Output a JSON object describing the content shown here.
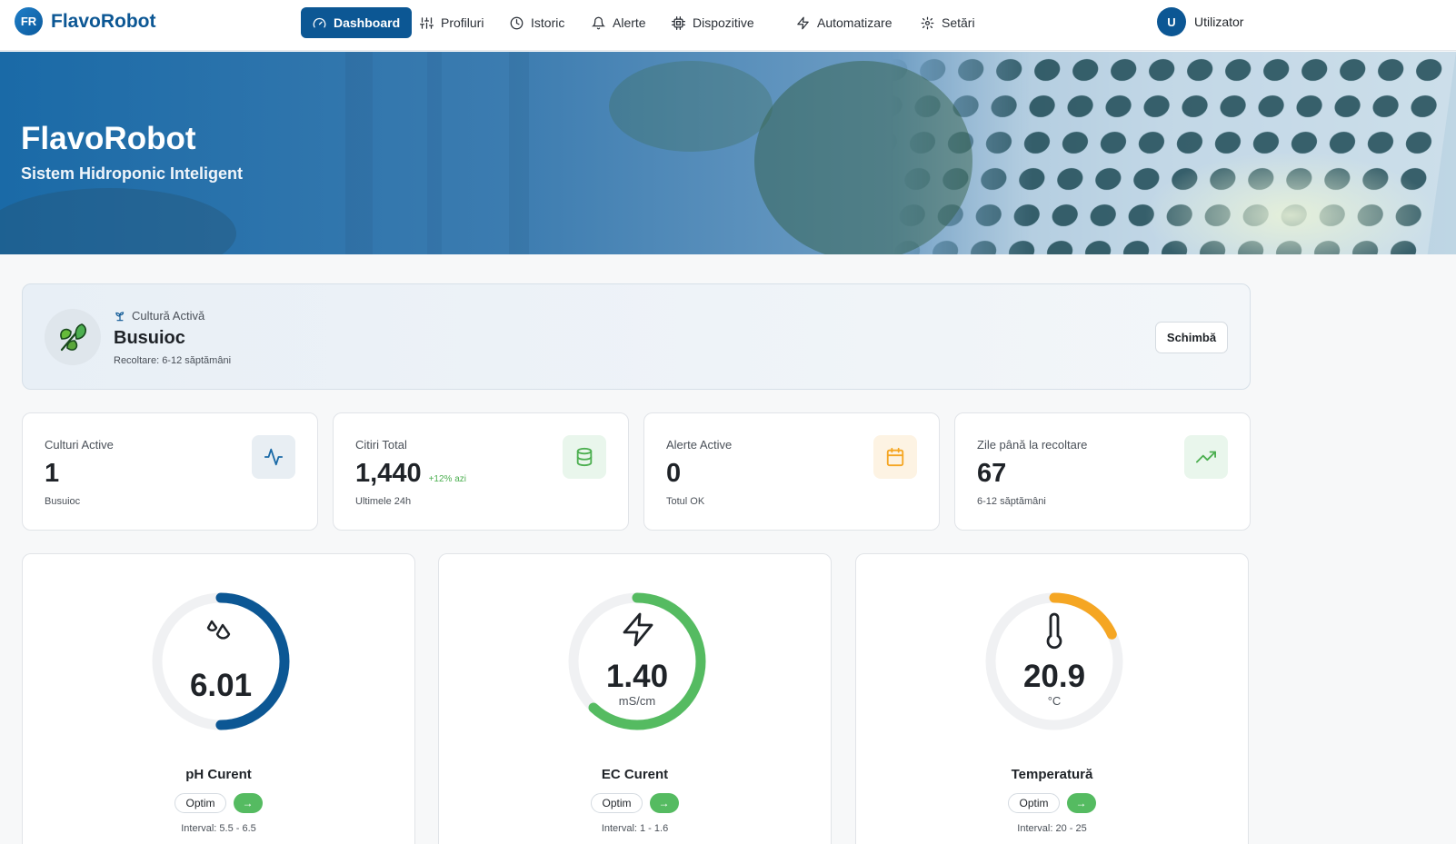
{
  "brand": {
    "logo_initials": "FR",
    "name": "FlavoRobot"
  },
  "nav": {
    "items": [
      {
        "label": "Dashboard",
        "icon": "gauge-icon",
        "active": true
      },
      {
        "label": "Profiluri",
        "icon": "sliders-icon"
      },
      {
        "label": "Istoric",
        "icon": "clock-icon"
      },
      {
        "label": "Alerte",
        "icon": "bell-icon"
      },
      {
        "label": "Dispozitive",
        "icon": "chip-icon"
      },
      {
        "label": "Automatizare",
        "icon": "zap-icon"
      },
      {
        "label": "Setări",
        "icon": "gear-icon"
      }
    ],
    "user": {
      "initial": "U",
      "name": "Utilizator"
    }
  },
  "hero": {
    "title": "FlavoRobot",
    "subtitle": "Sistem Hidroponic Inteligent"
  },
  "active_crop": {
    "label": "Cultură Activă",
    "name": "Busuioc",
    "harvest": "Recoltare: 6-12 săptămâni",
    "change_button": "Schimbă",
    "icon": "basil-leaf-icon"
  },
  "stats": [
    {
      "label": "Culturi Active",
      "value": "1",
      "delta": "",
      "sub": "Busuioc",
      "icon": "activity-icon",
      "color": "#1a6aa7",
      "bg": "#e8eef3"
    },
    {
      "label": "Citiri Total",
      "value": "1,440",
      "delta": "+12% azi",
      "sub": "Ultimele 24h",
      "icon": "database-icon",
      "color": "#4caf50",
      "bg": "#e9f6ec"
    },
    {
      "label": "Alerte Active",
      "value": "0",
      "delta": "",
      "sub": "Totul OK",
      "icon": "calendar-icon",
      "color": "#f5a623",
      "bg": "#fdf3e3"
    },
    {
      "label": "Zile până la recoltare",
      "value": "67",
      "delta": "",
      "sub": "6-12 săptămâni",
      "icon": "trending-up-icon",
      "color": "#4caf50",
      "bg": "#e9f6ec"
    }
  ],
  "gauges": [
    {
      "title": "pH Curent",
      "value": "6.01",
      "unit": "",
      "fraction": 0.5,
      "color": "#0c5794",
      "icon": "droplets-icon",
      "status": "Optim",
      "trend": "→",
      "range": "Interval: 5.5 - 6.5"
    },
    {
      "title": "EC Curent",
      "value": "1.40",
      "unit": "mS/cm",
      "fraction": 0.62,
      "color": "#55bb61",
      "icon": "zap-icon",
      "status": "Optim",
      "trend": "→",
      "range": "Interval: 1 - 1.6"
    },
    {
      "title": "Temperatură",
      "value": "20.9",
      "unit": "°C",
      "fraction": 0.18,
      "color": "#f5a623",
      "icon": "thermometer-icon",
      "status": "Optim",
      "trend": "→",
      "range": "Interval: 20 - 25"
    }
  ]
}
